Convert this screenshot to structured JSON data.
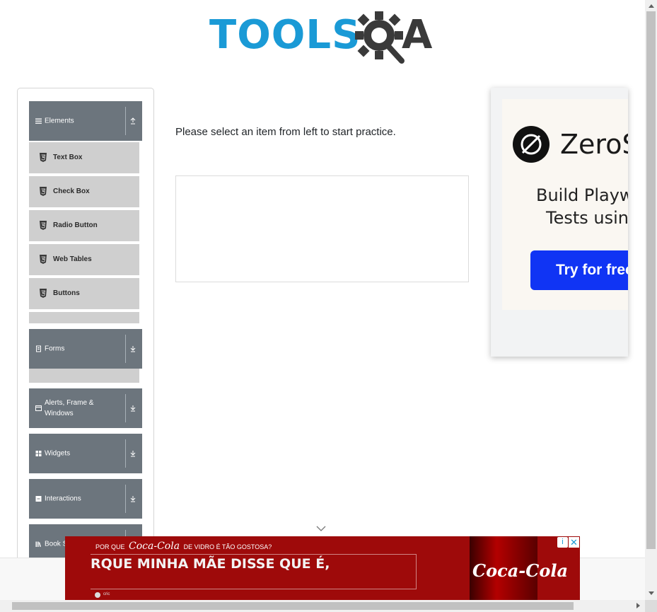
{
  "header": {
    "logo_text": "TOOLS",
    "logo_suffix": "A",
    "logo_icon": "gear-magnifier-icon"
  },
  "sidebar": {
    "groups": [
      {
        "label": "Elements",
        "icon": "hamburger-icon",
        "state": "expanded",
        "arrow": "collapse-icon"
      },
      {
        "label": "Forms",
        "icon": "document-icon",
        "state": "collapsed",
        "arrow": "expand-icon"
      },
      {
        "label": "Alerts, Frame & Windows",
        "icon": "window-icon",
        "state": "collapsed",
        "arrow": "expand-icon"
      },
      {
        "label": "Widgets",
        "icon": "grid-icon",
        "state": "collapsed",
        "arrow": "expand-icon"
      },
      {
        "label": "Interactions",
        "icon": "interactions-icon",
        "state": "collapsed",
        "arrow": "expand-icon"
      },
      {
        "label": "Book Store Application",
        "icon": "book-icon",
        "state": "collapsed",
        "arrow": "expand-icon"
      }
    ],
    "element_items": [
      {
        "label": "Text Box",
        "icon": "html5-icon"
      },
      {
        "label": "Check Box",
        "icon": "html5-icon"
      },
      {
        "label": "Radio Button",
        "icon": "html5-icon"
      },
      {
        "label": "Web Tables",
        "icon": "html5-icon"
      },
      {
        "label": "Buttons",
        "icon": "html5-icon"
      }
    ],
    "book_store_visible": "Book S"
  },
  "main": {
    "instruction": "Please select an item from left to start practice."
  },
  "ad_right": {
    "brand": "ZeroS",
    "line1": "Build Playwr",
    "line2": "Tests using",
    "button": "Try for free"
  },
  "ad_bottom": {
    "question_pre": "POR QUE",
    "question_brand": "Coca-Cola",
    "question_post": "DE VIDRO É TÃO GOSTOSA?",
    "headline": "RQUE MINHA MÃE DISSE QUE É,",
    "bottle_brand": "Coca-Cola",
    "footer": "cric",
    "info": "i",
    "close": "✕"
  },
  "colors": {
    "brand_blue": "#1a9ad6",
    "sidebar_header": "#6c757d",
    "sidebar_item": "#cfcfcf",
    "ad_button": "#1034f4",
    "coke_red": "#9e0a0a"
  }
}
